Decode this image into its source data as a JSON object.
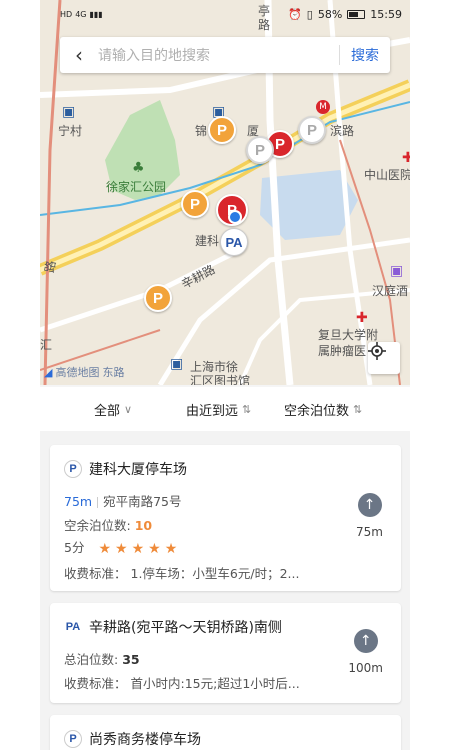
{
  "status": {
    "left_icons": [
      "HD",
      "4G",
      "signal-icon"
    ],
    "battery": "58%",
    "time": "15:59"
  },
  "search": {
    "placeholder": "请输入目的地搜索",
    "button": "搜索"
  },
  "map": {
    "labels": {
      "ting": "亭",
      "lu": "路",
      "ningcun": "宁村",
      "jin": "锦",
      "sha": "厦",
      "bin": "滨路",
      "xujiahui_park": "徐家汇公园",
      "jianke": "建科",
      "xinggeng": "辛耕路",
      "zhongshan": "中山医院",
      "hanting": "汉庭酒",
      "fudan": "复旦大学附",
      "fudan2": "属肿瘤医",
      "library1": "上海市徐",
      "library2": "汇区图书馆",
      "hui": "汇",
      "logo": "高德地图",
      "bottom_road": "东路",
      "left_road": "路"
    },
    "pins": [
      "P",
      "P",
      "P",
      "P",
      "P",
      "P",
      "P",
      "P",
      "PA"
    ]
  },
  "filters": {
    "all": "全部",
    "distance": "由近到远",
    "spaces": "空余泊位数",
    "sort_arrows": "⇅"
  },
  "cards": [
    {
      "icon": "P",
      "title": "建科大厦停车场",
      "distance": "75m",
      "address": "宛平南路75号",
      "free_label": "空余泊位数:",
      "free_value": "10",
      "score": "5分",
      "stars": [
        "★",
        "★",
        "★",
        "★",
        "★"
      ],
      "fee_label": "收费标准：",
      "fee": "1.停车场：小型车6元/时；2...",
      "nav_distance": "75m"
    },
    {
      "icon": "PA",
      "title": "辛耕路(宛平路～天钥桥路)南侧",
      "total_label": "总泊位数:",
      "total_value": "35",
      "fee_label": "收费标准：",
      "fee": "首小时内:15元;超过1小时后...",
      "nav_distance": "100m"
    },
    {
      "icon": "P",
      "title": "尚秀商务楼停车场"
    }
  ]
}
